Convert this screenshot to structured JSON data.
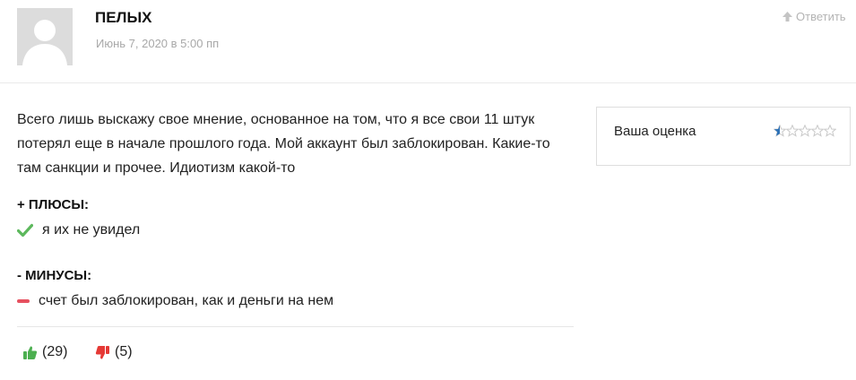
{
  "review": {
    "author": "ПЕЛЫХ",
    "date": "Июнь 7, 2020 в 5:00 пп",
    "reply_label": "Ответить",
    "text": "Всего лишь выскажу свое мнение, основанное на том, что я все свои 11 штук потерял еще в начале прошлого года. Мой аккаунт был заблокирован. Какие-то там санкции и прочее. Идиотизм какой-то",
    "pros_heading": "+ ПЛЮСЫ:",
    "pros": [
      "я их не увидел"
    ],
    "cons_heading": "- МИНУСЫ:",
    "cons": [
      "счет был заблокирован, как и деньги на нем"
    ],
    "votes_up": "(29)",
    "votes_down": "(5)"
  },
  "rating": {
    "label": "Ваша оценка",
    "value": 0.5,
    "max": 5
  },
  "icons": {
    "reply": "arrow-up-icon",
    "pro": "check-icon",
    "con": "minus-icon",
    "vote_up": "thumbs-up-icon",
    "vote_down": "thumbs-down-icon",
    "star": "star-icon"
  },
  "colors": {
    "check": "#5cb85c",
    "minus": "#e6505f",
    "thumb_up": "#4caf50",
    "thumb_down": "#e53935",
    "star_fill": "#2f73b8",
    "star_empty": "#c9c9c9"
  }
}
